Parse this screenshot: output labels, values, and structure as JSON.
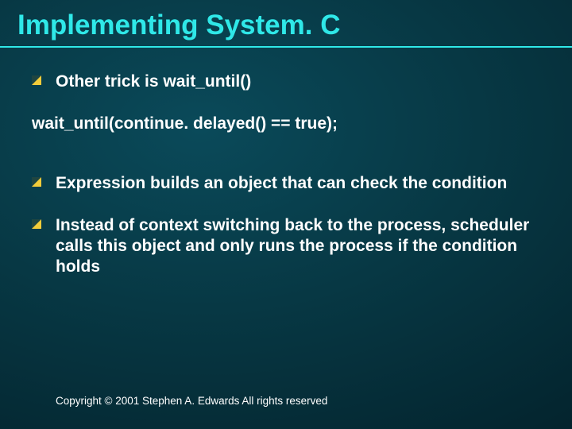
{
  "title": "Implementing System. C",
  "bullets": {
    "b1": "Other trick is wait_until()",
    "b2": "Expression builds an object that can check the condition",
    "b3": "Instead of context switching back to the process, scheduler calls this object and only runs the process if the condition holds"
  },
  "code": "wait_until(continue. delayed() == true);",
  "footer": "Copyright © 2001 Stephen A. Edwards  All rights reserved"
}
